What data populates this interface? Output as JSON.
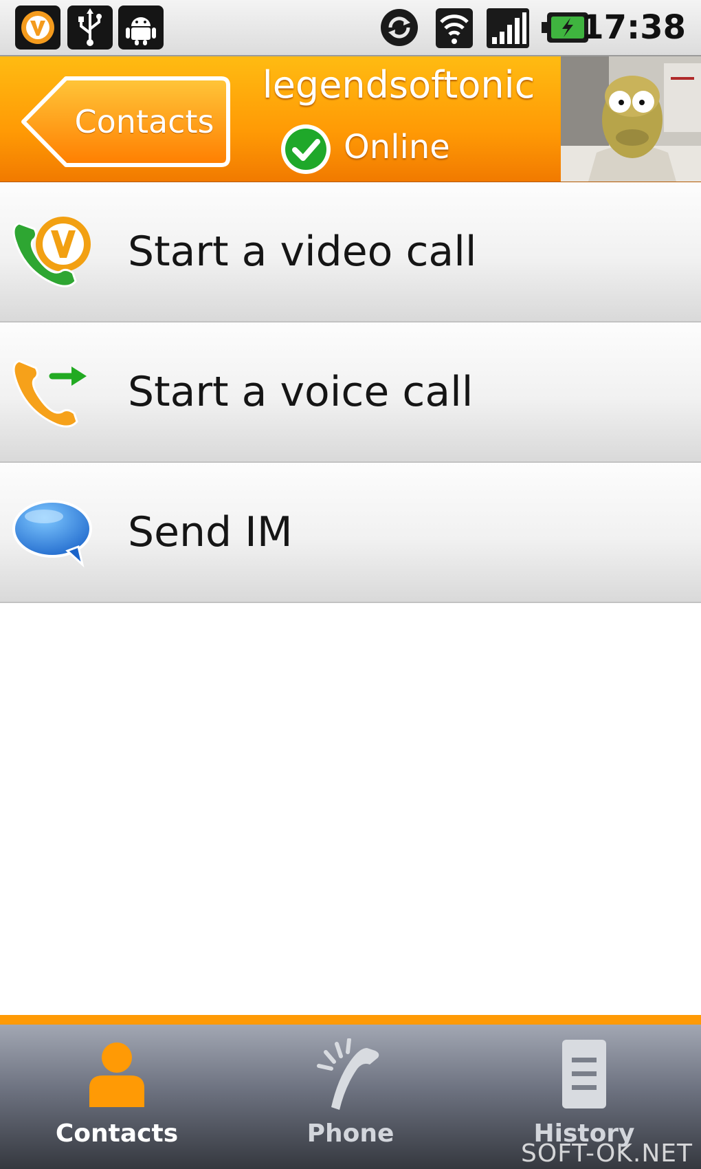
{
  "status_bar": {
    "time": "17:38",
    "icons": [
      "oovoo-notification-icon",
      "usb-icon",
      "android-debug-icon",
      "sync-icon",
      "wifi-icon",
      "signal-icon",
      "battery-charging-icon"
    ]
  },
  "header": {
    "back_label": "Contacts",
    "username": "legendsoftonic",
    "status": "Online",
    "colors": {
      "accent": "#ff9a05",
      "status_ok": "#1fa82a"
    }
  },
  "actions": [
    {
      "label": "Start a video call",
      "icon": "video-call-icon"
    },
    {
      "label": "Start a voice call",
      "icon": "voice-call-icon"
    },
    {
      "label": "Send IM",
      "icon": "chat-bubble-icon"
    }
  ],
  "tabs": [
    {
      "label": "Contacts",
      "icon": "person-icon",
      "active": true
    },
    {
      "label": "Phone",
      "icon": "phone-icon",
      "active": false
    },
    {
      "label": "History",
      "icon": "history-icon",
      "active": false
    }
  ],
  "watermark": "SOFT-OK.NET"
}
